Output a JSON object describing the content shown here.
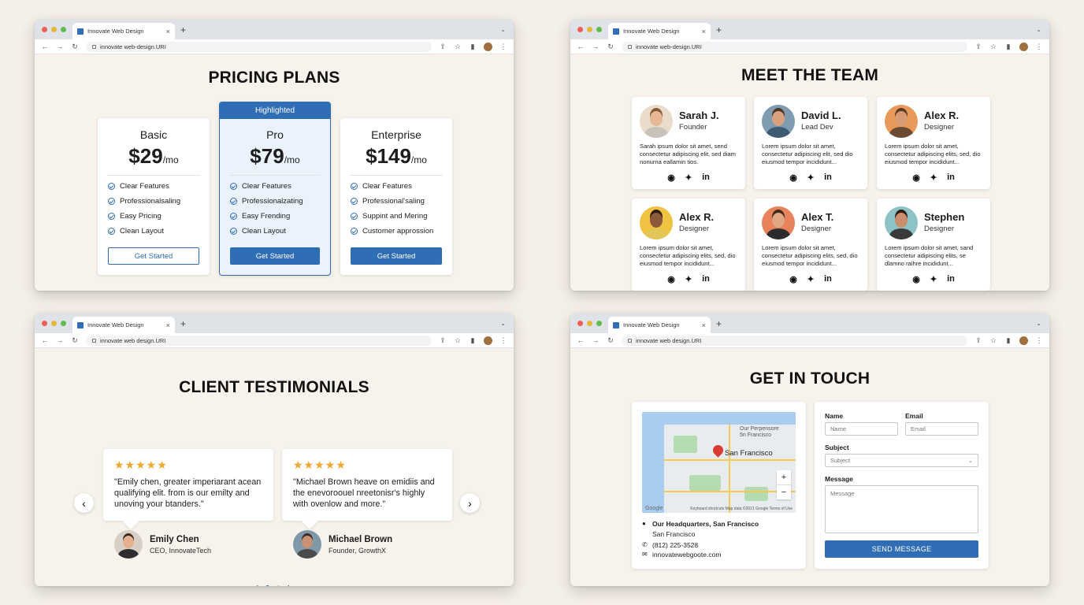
{
  "browser": {
    "tab_title": "Innovate Web Design",
    "tab_close": "×",
    "new_tab": "+",
    "tab_menu": "⌄",
    "url_dashes": "innovate web-design.URI",
    "url_spaces": "innovate web design.URI"
  },
  "pricing": {
    "title": "PRICING PLANS",
    "plans": [
      {
        "name": "Basic",
        "price": "$29",
        "period": "/mo",
        "features": [
          "Clear Features",
          "Professionalsaling",
          "Easy Pricing",
          "Clean Layout"
        ],
        "cta": "Get Started",
        "style": "outline"
      },
      {
        "name": "Pro",
        "badge": "Highlighted",
        "price": "$79",
        "period": "/mo",
        "features": [
          "Clear Features",
          "Professionalzating",
          "Easy Frending",
          "Clean Layout"
        ],
        "cta": "Get Started",
        "style": "solid"
      },
      {
        "name": "Enterprise",
        "price": "$149",
        "period": "/mo",
        "features": [
          "Clear Features",
          "Professional'saling",
          "Suppint and Mering",
          "Customer approssion"
        ],
        "cta": "Get Started",
        "style": "solid"
      }
    ]
  },
  "team": {
    "title": "MEET THE TEAM",
    "members": [
      {
        "name": "Sarah J.",
        "role": "Founder",
        "bio": "Sarah ipsum dolor sit amet, send consectetur adipiscing elit, sed diam nonurna eallamin tios.",
        "skin": "#e8b895",
        "hair": "#8a5a34",
        "shirt": "#c9c2b8",
        "bg": "#e9dccd"
      },
      {
        "name": "David L.",
        "role": "Lead Dev",
        "bio": "Lorem ipsum dolor sit amet, consectetur adipiscing elit, sed dio eiusmod tempor incididunt...",
        "skin": "#d9a27e",
        "hair": "#4a3526",
        "shirt": "#3f5a73",
        "bg": "#7e9bb0"
      },
      {
        "name": "Alex R.",
        "role": "Designer",
        "bio": "Lorem ipsum dolor sit amet, consectetur adipiscing elits, sed, dio eiusmod tempor incididunt...",
        "skin": "#d99b74",
        "hair": "#5b3a25",
        "shirt": "#6b4a34",
        "bg": "#e89a5a"
      },
      {
        "name": "Alex R.",
        "role": "Designer",
        "bio": "Lorem ipsum dolor sit amet, consectetur adipiscing elits, sed, dio eiusmod tempor incididunt...",
        "skin": "#8a5a3b",
        "hair": "#2e1d14",
        "shirt": "#e3c65a",
        "bg": "#f0c340"
      },
      {
        "name": "Alex T.",
        "role": "Designer",
        "bio": "Lorem ipsum dolor sit amet, consectetur adipiscing elits, sed, dio eiusmod tempor incididunt...",
        "skin": "#e0a884",
        "hair": "#3d2a1e",
        "shirt": "#2c2c2c",
        "bg": "#e8825a"
      },
      {
        "name": "Stephen",
        "role": "Designer",
        "bio": "Lorem ipsum dolor sit amet, sand consectetur adipiscing elits, se dlamno raihre incididunt...",
        "skin": "#c98e6c",
        "hair": "#2b1d16",
        "shirt": "#3a3a3a",
        "bg": "#8dc3c6"
      }
    ],
    "social_icons": [
      "github-icon",
      "twitter-icon",
      "linkedin-icon"
    ]
  },
  "testimonials": {
    "title": "CLIENT TESTIMONIALS",
    "items": [
      {
        "stars": "★★★★★",
        "quote": "\"Emily chen, greater imperiarant acean qualifying elit. from is our emilty and unoving your btanders.\"",
        "name": "Emily Chen",
        "role": "CEO, InnovateTech",
        "skin": "#e4b08f",
        "hair": "#3a271c",
        "shirt": "#2d2d2d",
        "bg": "#d8d0c6"
      },
      {
        "stars": "★★★★★",
        "quote": "\"Michael Brown heave on emidiis and the enevoroouel nreetonisr's highly with ovenlow and more.\"",
        "name": "Michael Brown",
        "role": "Founder, GrowthX",
        "skin": "#c99274",
        "hair": "#3a2a20",
        "shirt": "#4a4a4a",
        "bg": "#7f99a8"
      }
    ],
    "prev": "‹",
    "next": "›",
    "pager_prev": "‹",
    "pager_next": "›"
  },
  "contact": {
    "title": "GET IN TOUCH",
    "map_label": "San Francisco",
    "map_label_small": "Our Perpensore\n5n Francisco",
    "map_google": "Google",
    "map_footer": "Keyboard shortcuts   Map data ©2021 Google   Terms of Use",
    "zoom_in": "+",
    "zoom_out": "−",
    "hq_title": "Our Headquarters, San Francisco",
    "hq_city": "San Francisco",
    "phone": "(812) 225-3528",
    "email": "innovatewebgoote.com",
    "form": {
      "name_label": "Name",
      "name_placeholder": "Name",
      "email_label": "Email",
      "email_placeholder": "Email",
      "subject_label": "Subject",
      "subject_placeholder": "Subject",
      "message_label": "Message",
      "message_placeholder": "Message",
      "submit": "SEND MESSAGE"
    }
  },
  "colors": {
    "accent": "#2f6db4",
    "star": "#f0a72e",
    "background": "#f4efe7"
  }
}
